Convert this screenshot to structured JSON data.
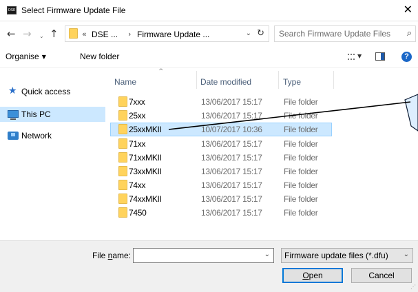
{
  "window": {
    "title": "Select Firmware Update File",
    "close_glyph": "✕"
  },
  "address": {
    "back_glyph": "←",
    "forward_glyph": "→",
    "recent_glyph": "⌄",
    "up_glyph": "↑",
    "overflow": "«",
    "segments": [
      "DSE ...",
      "Firmware Update ..."
    ],
    "separator": "›",
    "dropdown_glyph": "⌄",
    "refresh_glyph": "↻",
    "search_placeholder": "Search Firmware Update Files",
    "search_glyph": "⌕"
  },
  "toolbar": {
    "organise_label": "Organise",
    "organise_caret": "▼",
    "new_folder_label": "New folder",
    "view_caret": "▼",
    "help_label": "?"
  },
  "nav": {
    "items": [
      {
        "label": "Quick access",
        "icon": "star-icon"
      },
      {
        "label": "This PC",
        "icon": "computer-icon",
        "selected": true
      },
      {
        "label": "Network",
        "icon": "network-icon"
      }
    ]
  },
  "columns": {
    "name": "Name",
    "date": "Date modified",
    "type": "Type",
    "sort_glyph": "^"
  },
  "files": [
    {
      "name": "7xxx",
      "date": "13/06/2017 15:17",
      "type": "File folder"
    },
    {
      "name": "25xx",
      "date": "13/06/2017 15:17",
      "type": "File folder"
    },
    {
      "name": "25xxMKII",
      "date": "10/07/2017 10:36",
      "type": "File folder",
      "selected": true
    },
    {
      "name": "71xx",
      "date": "13/06/2017 15:17",
      "type": "File folder"
    },
    {
      "name": "71xxMKII",
      "date": "13/06/2017 15:17",
      "type": "File folder"
    },
    {
      "name": "73xxMKII",
      "date": "13/06/2017 15:17",
      "type": "File folder"
    },
    {
      "name": "74xx",
      "date": "13/06/2017 15:17",
      "type": "File folder"
    },
    {
      "name": "74xxMKII",
      "date": "13/06/2017 15:17",
      "type": "File folder"
    },
    {
      "name": "7450",
      "date": "13/06/2017 15:17",
      "type": "File folder"
    }
  ],
  "bottom": {
    "file_name_pre": "File ",
    "file_name_ul": "n",
    "file_name_post": "ame:",
    "file_name_value": "",
    "dropdown_glyph": "⌄",
    "filter_value": "Firmware update files (*.dfu)",
    "open_ul": "O",
    "open_rest": "pen",
    "cancel_label": "Cancel",
    "grip_glyph": "⋰"
  },
  "colors": {
    "selection": "#cce8ff",
    "selection_border": "#99d1ff",
    "folder": "#ffd35c",
    "accent": "#0078d7",
    "header_text": "#4c607a"
  }
}
